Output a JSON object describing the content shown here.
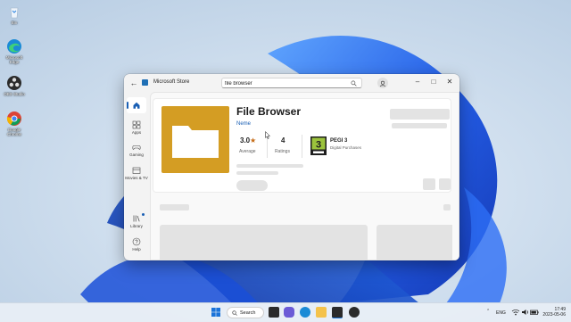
{
  "desktop": {
    "icons": [
      {
        "label": "Bin"
      },
      {
        "label": "Microsoft Edge"
      },
      {
        "label": "OBS Studio"
      },
      {
        "label": "Google Chrome"
      }
    ]
  },
  "window": {
    "title": "Microsoft Store",
    "search_value": "file browser",
    "sidebar": [
      {
        "label": "Apps"
      },
      {
        "label": "Gaming"
      },
      {
        "label": "Movies & TV"
      },
      {
        "label": "Library"
      },
      {
        "label": "Help"
      }
    ]
  },
  "app": {
    "name": "File Browser",
    "publisher": "Neme",
    "rating": "3.0",
    "rating_caption": "Average",
    "ratings_count": "4",
    "ratings_caption": "Ratings",
    "age_rating": "PEGI 3",
    "age_badge_number": "3",
    "purchase_type": "Digital Purchases",
    "icon_color": "#d49d23"
  },
  "taskbar": {
    "search_label": "Search",
    "language": "ENG",
    "time": "17:49",
    "date": "2023-05-06"
  },
  "colors": {
    "accent": "#1a5fb4",
    "star": "#c56b16"
  }
}
